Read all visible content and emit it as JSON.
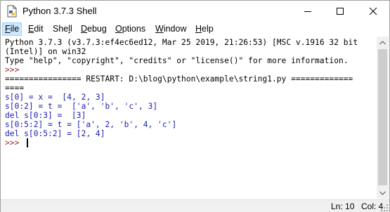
{
  "window": {
    "title": "Python 3.7.3 Shell"
  },
  "menu": {
    "items": [
      {
        "label_ul": "F",
        "label_rest": "ile"
      },
      {
        "label_ul": "E",
        "label_rest": "dit"
      },
      {
        "label_pre": "She",
        "label_ul": "l",
        "label_rest": "l"
      },
      {
        "label_ul": "D",
        "label_rest": "ebug"
      },
      {
        "label_ul": "O",
        "label_rest": "ptions"
      },
      {
        "label_ul": "W",
        "label_rest": "indow"
      },
      {
        "label_ul": "H",
        "label_rest": "elp"
      }
    ]
  },
  "shell": {
    "lines": [
      "Python 3.7.3 (v3.7.3:ef4ec6ed12, Mar 25 2019, 21:26:53) [MSC v.1916 32 bit",
      "(Intel)] on win32",
      "Type \"help\", \"copyright\", \"credits\" or \"license()\" for more information.",
      ">>> ",
      "================ RESTART: D:\\blog\\python\\example\\string1.py =============",
      "====",
      "s[0] = x =  [4, 2, 3]",
      "s[0:2] = t =  ['a', 'b', 'c', 3]",
      "del s[0:3] =  [3]",
      "s[0:5:2] = t = ['a', 2, 'b', 4, 'c']",
      "del s[0:5:2] = [2, 4]",
      ">>> "
    ]
  },
  "status": {
    "ln": "Ln: 10",
    "col": "Col: 4"
  },
  "colors": {
    "output_blue": "#1c1cb4",
    "prompt_red": "#9b1c1c",
    "menu_highlight": "#cce8ff"
  }
}
